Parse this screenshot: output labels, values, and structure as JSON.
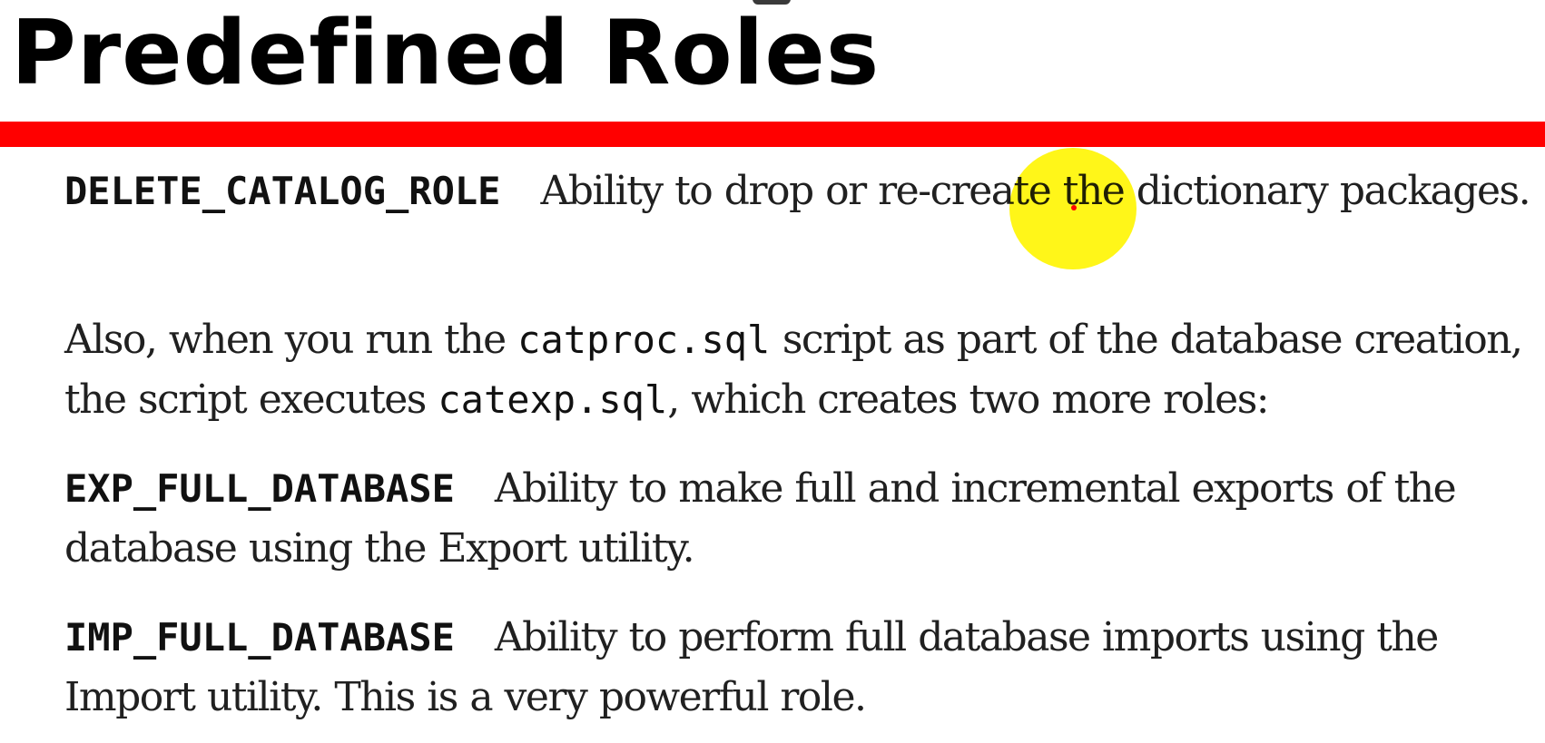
{
  "slide": {
    "title": "Predefined Roles",
    "accent_color": "#ff0000",
    "paragraphs": {
      "delete_catalog": {
        "role": "DELETE_CATALOG_ROLE",
        "text": "Ability to drop or re-create the dictionary packages."
      },
      "catproc": {
        "before": "Also, when you run the ",
        "code1": "catproc.sql",
        "middle": " script as part of the database creation, the script executes ",
        "code2": "catexp.sql",
        "after": ", which creates two more roles:"
      },
      "exp_full": {
        "role": "EXP_FULL_DATABASE",
        "text": "Ability to make full and incremental exports of the database using the Export utility."
      },
      "imp_full": {
        "role": "IMP_FULL_DATABASE",
        "text": "Ability to perform full database imports using the Import utility. This is a very powerful role."
      }
    }
  },
  "pointer": {
    "highlight_color": "#fff500",
    "dot_color": "#ff0000"
  }
}
